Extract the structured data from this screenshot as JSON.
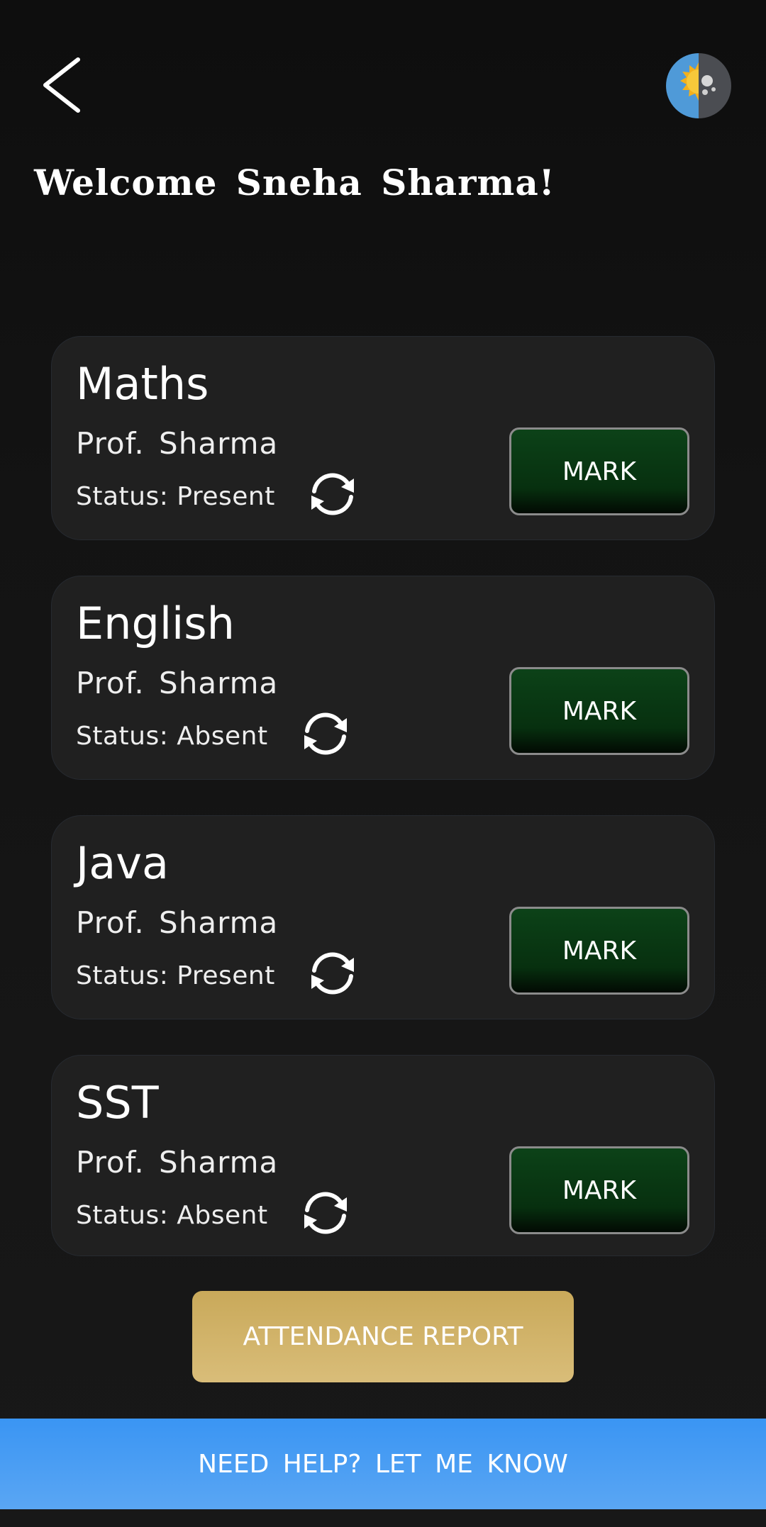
{
  "header": {
    "back_icon": "chevron-left-icon",
    "theme_icon": "sun-moon-toggle-icon",
    "welcome_text": "Welcome Sneha Sharma!"
  },
  "subjects": [
    {
      "title": "Maths",
      "professor": "Prof. Sharma",
      "status": "Status: Present",
      "mark_label": "MARK"
    },
    {
      "title": "English",
      "professor": "Prof. Sharma",
      "status": "Status: Absent",
      "mark_label": "MARK"
    },
    {
      "title": "Java",
      "professor": "Prof. Sharma",
      "status": "Status: Present",
      "mark_label": "MARK"
    },
    {
      "title": "SST",
      "professor": "Prof. Sharma",
      "status": "Status: Absent",
      "mark_label": "MARK"
    }
  ],
  "actions": {
    "report_label": "ATTENDANCE REPORT",
    "help_label": "NEED HELP?  LET ME KNOW"
  },
  "colors": {
    "background": "#111111",
    "card": "#202020",
    "mark_button": "#0c4218",
    "report_button": "#d0b26a",
    "help_bar": "#3f98f4"
  }
}
